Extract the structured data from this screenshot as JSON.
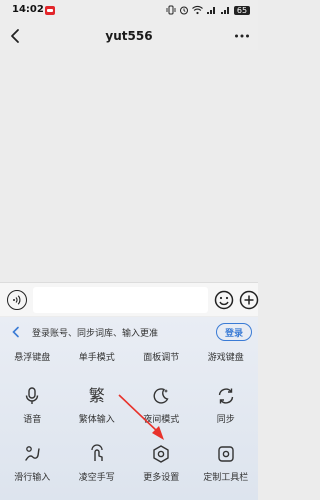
{
  "status_bar": {
    "time": "14:02",
    "battery": "65"
  },
  "header": {
    "title": "yut556",
    "back_icon": "chevron-left-icon",
    "more_icon": "more-dots-icon"
  },
  "input_bar": {
    "voice_icon": "voice-icon",
    "emoji_icon": "emoji-icon",
    "plus_icon": "plus-icon"
  },
  "keyboard": {
    "login_hint": "登录账号、同步词库、输入更准",
    "login_button": "登录",
    "row0": [
      "悬浮键盘",
      "单手模式",
      "面板调节",
      "游戏键盘"
    ],
    "row1": [
      {
        "label": "语音",
        "icon": "microphone-icon"
      },
      {
        "label": "繁体输入",
        "icon": "traditional-chinese-icon",
        "glyph": "繁"
      },
      {
        "label": "夜间模式",
        "icon": "moon-icon"
      },
      {
        "label": "同步",
        "icon": "sync-icon"
      }
    ],
    "row2": [
      {
        "label": "滑行输入",
        "icon": "swipe-input-icon"
      },
      {
        "label": "凌空手写",
        "icon": "handwriting-icon"
      },
      {
        "label": "更多设置",
        "icon": "settings-hexagon-icon"
      },
      {
        "label": "定制工具栏",
        "icon": "toolbar-custom-icon"
      }
    ]
  },
  "colors": {
    "accent": "#3a7bd5",
    "annotation_arrow": "#e8322b",
    "status_badge": "#e2262b"
  }
}
